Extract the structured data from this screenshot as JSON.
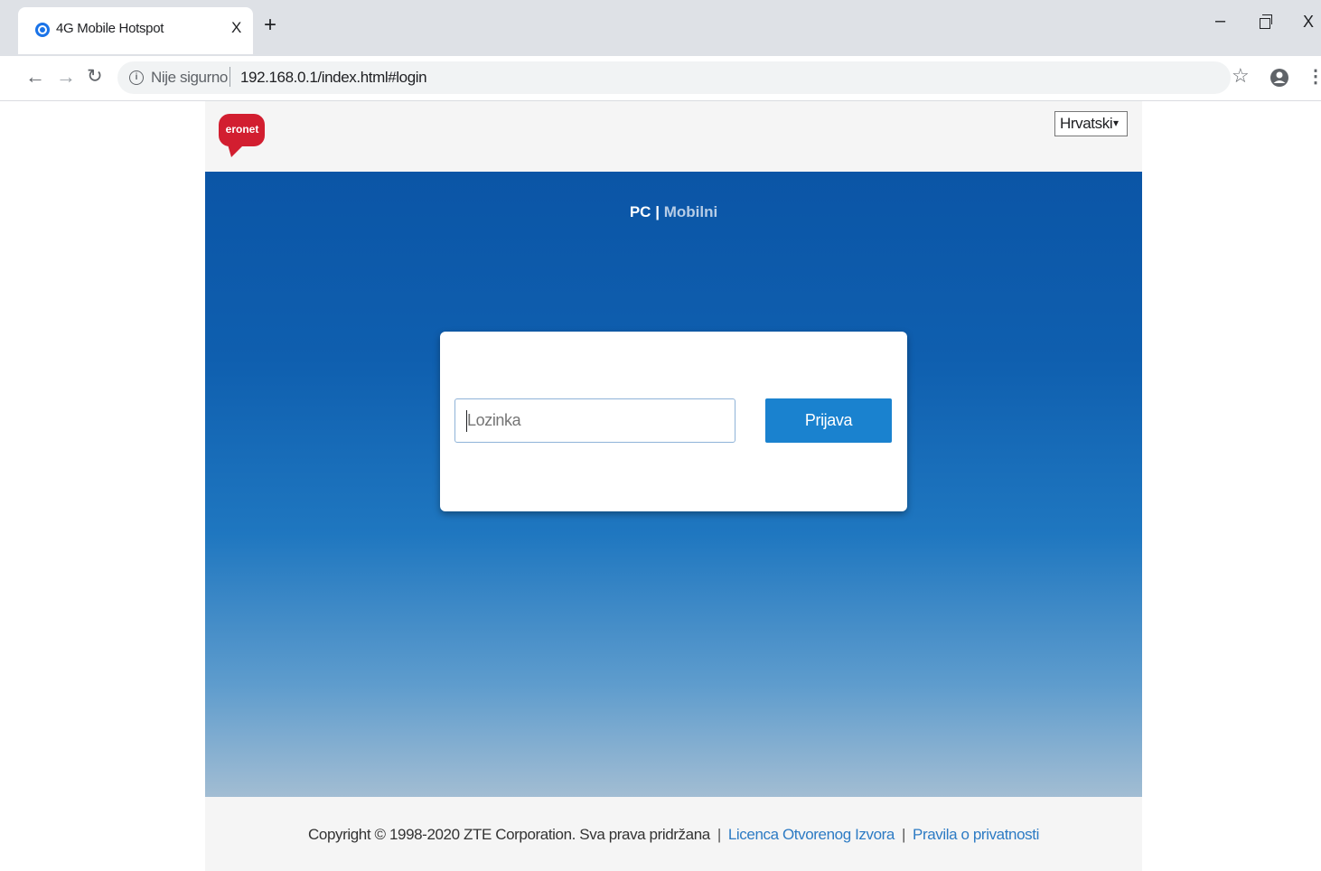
{
  "browser": {
    "tab_title": "4G Mobile Hotspot",
    "tab_close": "X",
    "new_tab": "+",
    "window_minimize": "–",
    "window_close": "X",
    "security_label": "Nije sigurno",
    "url": "192.168.0.1/index.html#login",
    "icons": [
      "favicon-icon",
      "back-arrow-icon",
      "forward-arrow-icon",
      "reload-icon",
      "info-icon",
      "star-icon",
      "account-icon",
      "menu-icon"
    ]
  },
  "header": {
    "logo_text": "eronet",
    "language_selected": "Hrvatski"
  },
  "mode_switch": {
    "pc": "PC",
    "separator": "|",
    "mobile": "Mobilni"
  },
  "login": {
    "password_placeholder": "Lozinka",
    "password_value": "",
    "submit_label": "Prijava"
  },
  "footer": {
    "copyright": "Copyright © 1998-2020 ZTE Corporation. Sva prava pridržana",
    "separator": "|",
    "open_source_link": "Licenca Otvorenog Izvora",
    "privacy_link": "Pravila o privatnosti"
  },
  "colors": {
    "brand_red": "#d21e30",
    "hero_top": "#0b55a6",
    "hero_bottom": "#a2bdd3",
    "button_blue": "#1a82cf",
    "link_blue": "#2d7bc4"
  }
}
